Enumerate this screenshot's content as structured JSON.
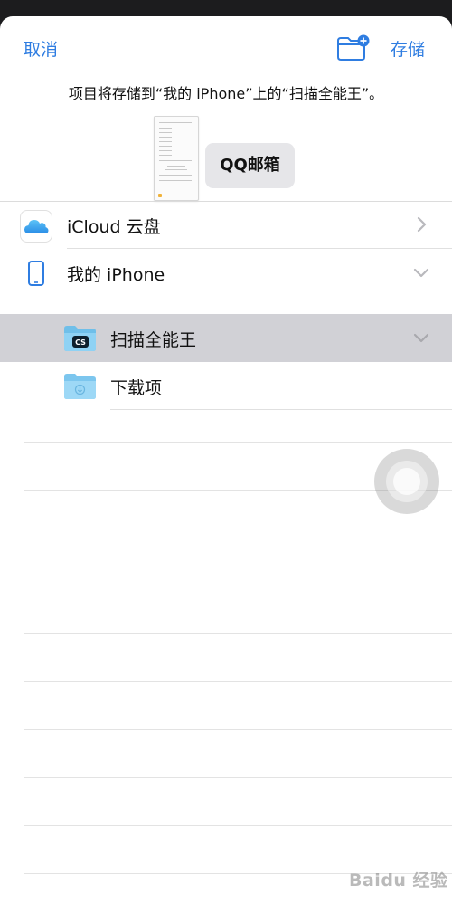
{
  "nav": {
    "cancel_label": "取消",
    "new_folder_icon": "folder-plus-icon",
    "save_label": "存储"
  },
  "save_message": "项目将存储到“我的 iPhone”上的“扫描全能王”。",
  "document": {
    "name": "QQ邮箱"
  },
  "locations": [
    {
      "label": "iCloud 云盘",
      "icon": "icloud-icon",
      "chevron": "chevron-right",
      "selected": false
    },
    {
      "label": "我的 iPhone",
      "icon": "iphone-icon",
      "chevron": "chevron-down",
      "selected": false
    },
    {
      "label": "扫描全能王",
      "icon": "camscanner-folder-icon",
      "badge": "CS",
      "chevron": "chevron-down",
      "selected": true
    },
    {
      "label": "下载项",
      "icon": "downloads-folder-icon",
      "selected": false
    }
  ],
  "colors": {
    "accent": "#2f7de1",
    "selected_row": "#d1d1d6",
    "folder": "#7fc8f0"
  },
  "watermark": "Baidu 经验"
}
